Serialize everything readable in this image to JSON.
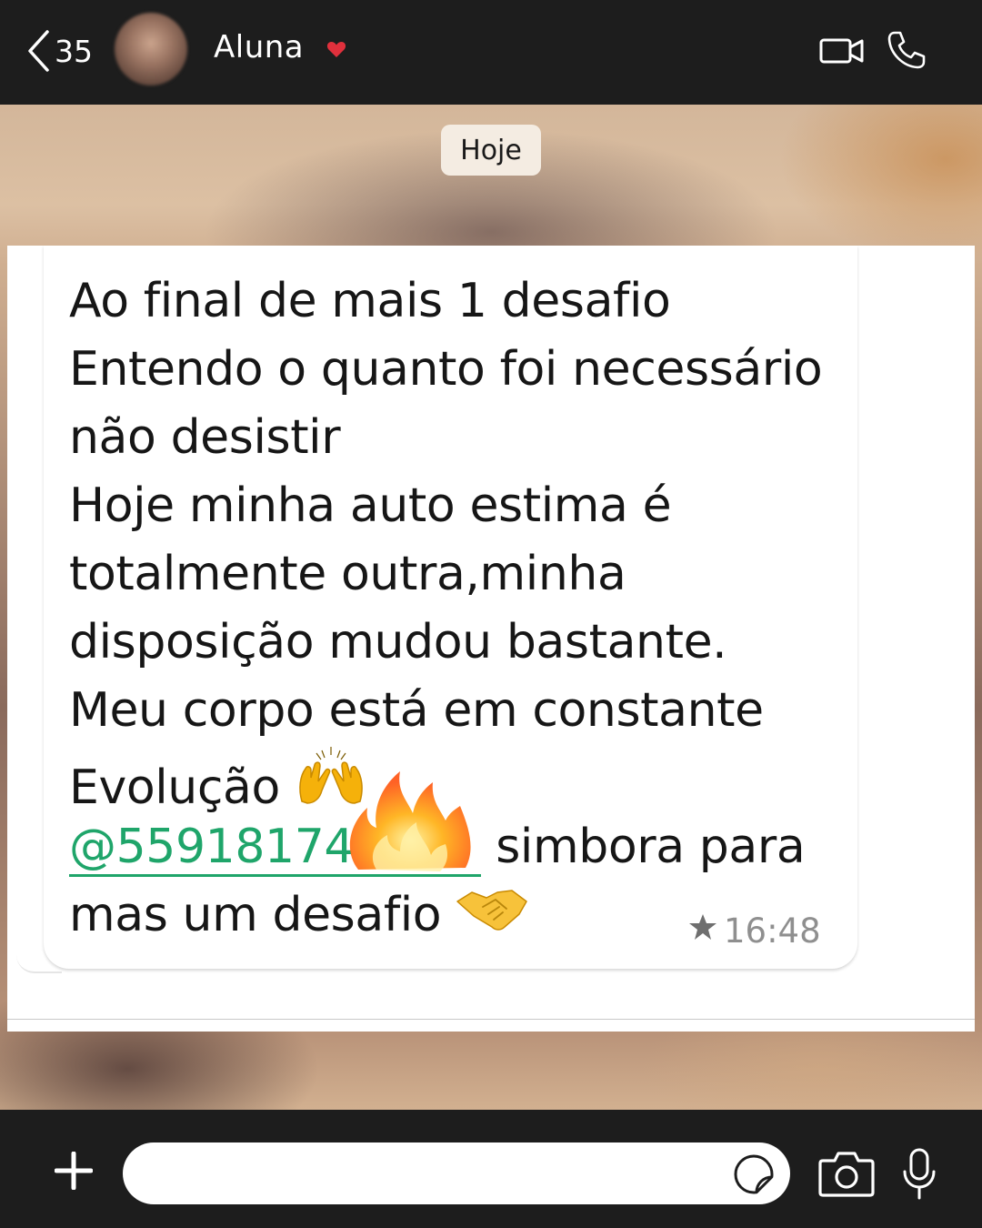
{
  "header": {
    "back_count": "35",
    "contact_name": "Aluna",
    "icons": [
      "back-icon",
      "heart-icon",
      "video-call-icon",
      "phone-call-icon"
    ]
  },
  "chat": {
    "date_label": "Hoje",
    "message": {
      "lines": [
        "Ao final de mais 1 desafio",
        "Entendo o quanto foi necessário",
        "não desistir",
        "Hoje minha auto estima é",
        "totalmente outra,minha",
        "disposição mudou bastante.",
        "Meu corpo está em constante",
        "Evolução"
      ],
      "emoji_raising_hands": "🙌",
      "mention": "@55918174",
      "after_mention": "simbora para",
      "last_line": "mas um desafio",
      "emoji_handshake": "🤝",
      "time": "16:48",
      "starred": true
    }
  },
  "footer": {
    "input_value": "",
    "icons": [
      "plus-icon",
      "sticker-icon",
      "camera-icon",
      "microphone-icon"
    ]
  },
  "colors": {
    "bar_bg": "#1d1d1d",
    "mention": "#1fa56a",
    "heart": "#e0303c",
    "date_pill": "#f4ece2"
  }
}
